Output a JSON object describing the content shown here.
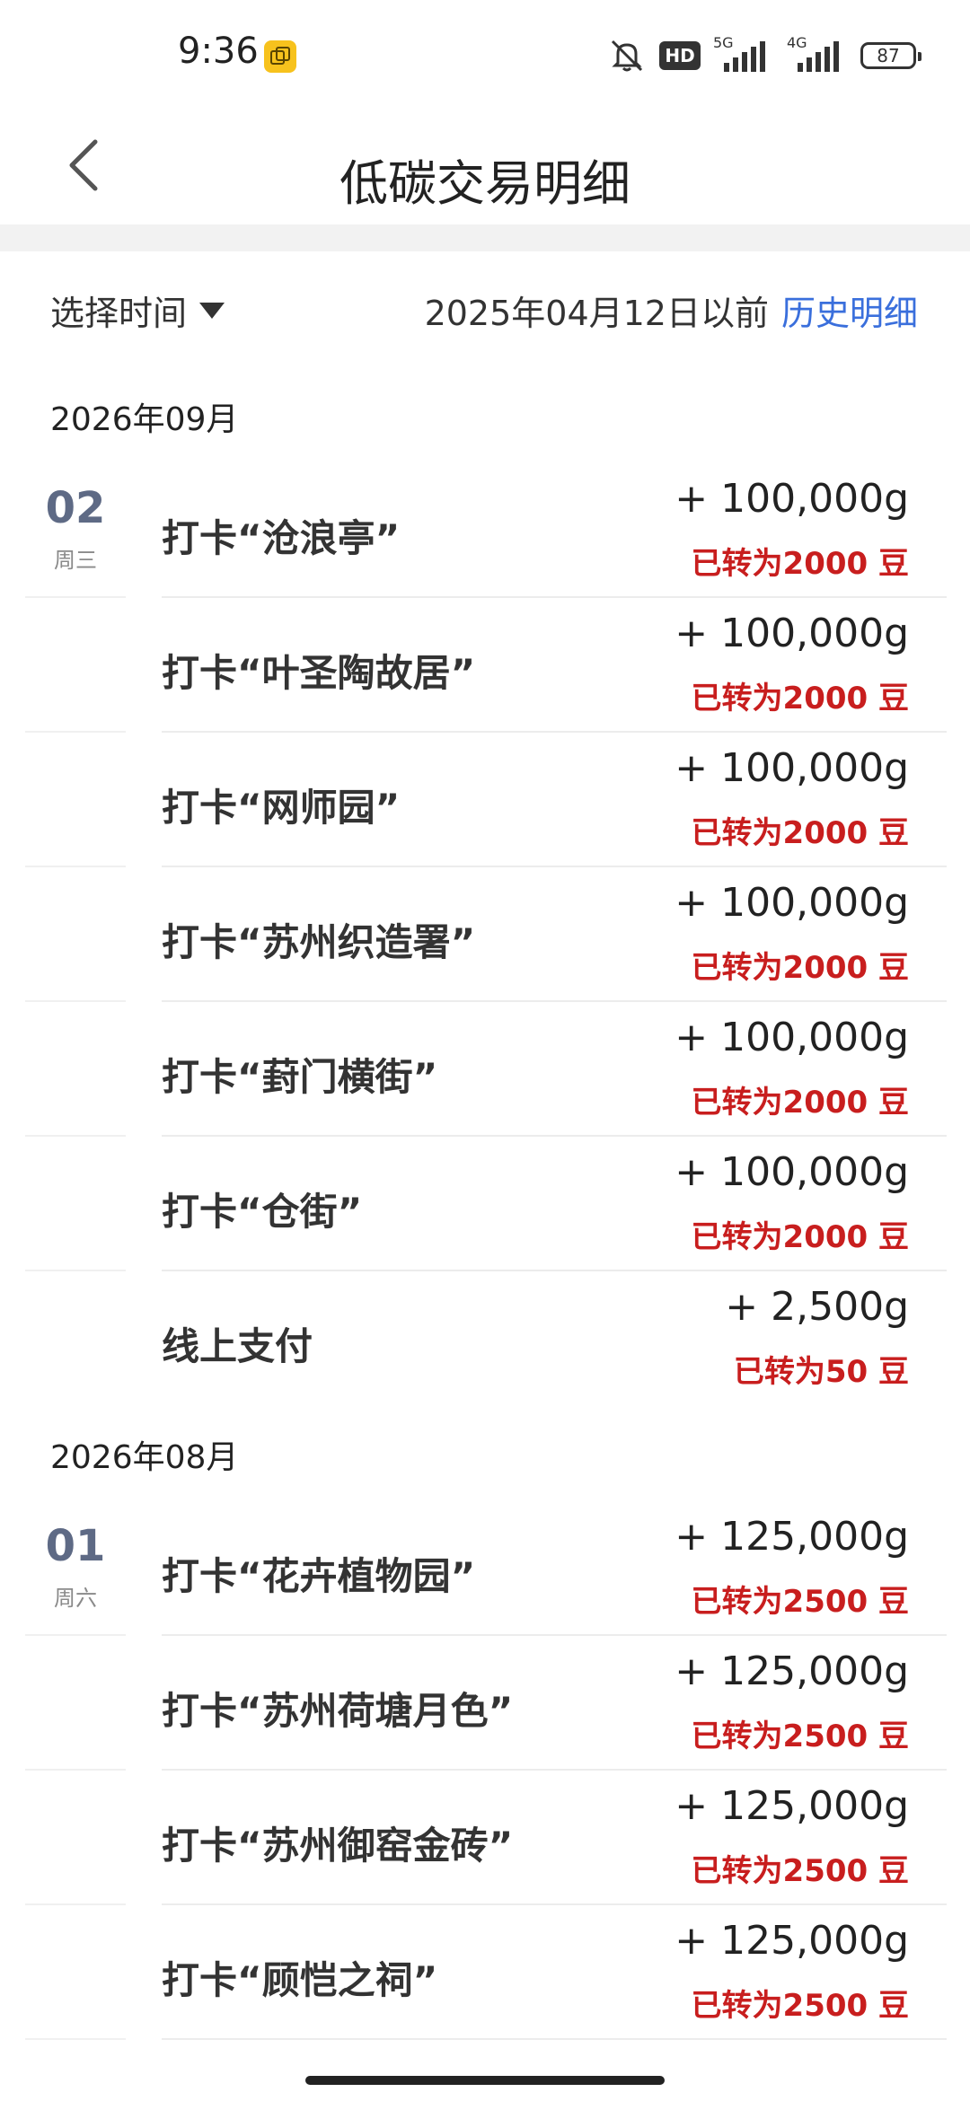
{
  "status_bar": {
    "time": "9:36",
    "net1": "5G",
    "net2": "4G",
    "hd": "HD",
    "battery": "87"
  },
  "header": {
    "title": "低碳交易明细"
  },
  "filter": {
    "select_label": "选择时间",
    "date_text": "2025年04月12日以前",
    "history_link": "历史明细"
  },
  "groups": [
    {
      "month": "2026年09月",
      "day": "02",
      "weekday": "周三",
      "items": [
        {
          "title": "打卡“沧浪亭”",
          "amount": "+ 100,000g",
          "converted": "已转为2000 豆"
        },
        {
          "title": "打卡“叶圣陶故居”",
          "amount": "+ 100,000g",
          "converted": "已转为2000 豆"
        },
        {
          "title": "打卡“网师园”",
          "amount": "+ 100,000g",
          "converted": "已转为2000 豆"
        },
        {
          "title": "打卡“苏州织造署”",
          "amount": "+ 100,000g",
          "converted": "已转为2000 豆"
        },
        {
          "title": "打卡“葑门横街”",
          "amount": "+ 100,000g",
          "converted": "已转为2000 豆"
        },
        {
          "title": "打卡“仓街”",
          "amount": "+ 100,000g",
          "converted": "已转为2000 豆"
        },
        {
          "title": "线上支付",
          "amount": "+ 2,500g",
          "converted": "已转为50 豆"
        }
      ]
    },
    {
      "month": "2026年08月",
      "day": "01",
      "weekday": "周六",
      "items": [
        {
          "title": "打卡“花卉植物园”",
          "amount": "+ 125,000g",
          "converted": "已转为2500 豆"
        },
        {
          "title": "打卡“苏州荷塘月色”",
          "amount": "+ 125,000g",
          "converted": "已转为2500 豆"
        },
        {
          "title": "打卡“苏州御窑金砖”",
          "amount": "+ 125,000g",
          "converted": "已转为2500 豆"
        },
        {
          "title": "打卡“顾恺之祠”",
          "amount": "+ 125,000g",
          "converted": "已转为2500 豆"
        }
      ]
    }
  ],
  "colors": {
    "link": "#3a6fdc",
    "converted": "#c81e1e",
    "day": "#5e6a85"
  }
}
